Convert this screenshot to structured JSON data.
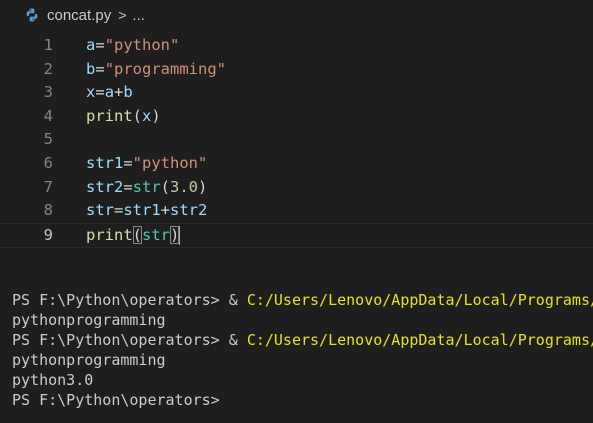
{
  "breadcrumb": {
    "file": "concat.py",
    "separator": ">",
    "ellipsis": "..."
  },
  "editor": {
    "active_line": 9,
    "lines": [
      {
        "number": "1",
        "tokens": [
          [
            "var",
            "a"
          ],
          [
            "op",
            "="
          ],
          [
            "str",
            "\"python\""
          ]
        ]
      },
      {
        "number": "2",
        "tokens": [
          [
            "var",
            "b"
          ],
          [
            "op",
            "="
          ],
          [
            "str",
            "\"programming\""
          ]
        ]
      },
      {
        "number": "3",
        "tokens": [
          [
            "var",
            "x"
          ],
          [
            "op",
            "="
          ],
          [
            "var",
            "a"
          ],
          [
            "op",
            "+"
          ],
          [
            "var",
            "b"
          ]
        ]
      },
      {
        "number": "4",
        "tokens": [
          [
            "fn",
            "print"
          ],
          [
            "op",
            "("
          ],
          [
            "var",
            "x"
          ],
          [
            "op",
            ")"
          ]
        ]
      },
      {
        "number": "5",
        "tokens": []
      },
      {
        "number": "6",
        "tokens": [
          [
            "var",
            "str1"
          ],
          [
            "op",
            "="
          ],
          [
            "str",
            "\"python\""
          ]
        ]
      },
      {
        "number": "7",
        "tokens": [
          [
            "var",
            "str2"
          ],
          [
            "op",
            "="
          ],
          [
            "cls",
            "str"
          ],
          [
            "op",
            "("
          ],
          [
            "num",
            "3.0"
          ],
          [
            "op",
            ")"
          ]
        ]
      },
      {
        "number": "8",
        "tokens": [
          [
            "var",
            "str"
          ],
          [
            "op",
            "="
          ],
          [
            "var",
            "str1"
          ],
          [
            "op",
            "+"
          ],
          [
            "var",
            "str2"
          ]
        ]
      },
      {
        "number": "9",
        "tokens": [
          [
            "fn",
            "print"
          ],
          [
            "op",
            "("
          ],
          [
            "cls",
            "str"
          ],
          [
            "op",
            ")"
          ]
        ]
      }
    ]
  },
  "terminal": {
    "prompt": "PS F:\\Python\\operators>",
    "command_prefix": " & ",
    "command_path": "C:/Users/Lenovo/AppData/Local/Programs/",
    "output_1": "pythonprogramming",
    "output_2": "pythonprogramming",
    "output_3": "python3.0"
  },
  "colors": {
    "background": "#1e1e1e",
    "variable": "#9cdcfe",
    "string": "#ce9178",
    "function": "#dcdcaa",
    "class": "#4ec9b0",
    "number": "#b5cea8",
    "terminal_path": "#e5e510"
  }
}
